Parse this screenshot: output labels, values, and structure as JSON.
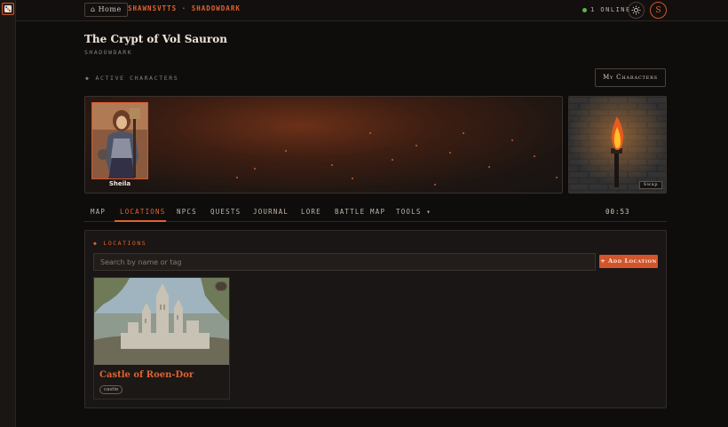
{
  "topbar": {
    "home_label": "Home",
    "brand": "SHAWNSVTTS · SHADOWDARK",
    "online": "1 ONLINE",
    "user_initial": "S"
  },
  "campaign": {
    "title": "The Crypt of Vol Sauron",
    "system": "SHADOWDARK"
  },
  "characters": {
    "heading": "ACTIVE CHARACTERS",
    "my_characters_label": "My Characters",
    "list": [
      {
        "name": "Sheila"
      }
    ]
  },
  "torch": {
    "swap_label": "Swap"
  },
  "tabs": [
    {
      "label": "MAP"
    },
    {
      "label": "LOCATIONS",
      "active": true
    },
    {
      "label": "NPCS"
    },
    {
      "label": "QUESTS"
    },
    {
      "label": "JOURNAL"
    },
    {
      "label": "LORE"
    },
    {
      "label": "BATTLE MAP"
    },
    {
      "label": "TOOLS ▾"
    }
  ],
  "timer": "00:53",
  "locations": {
    "heading": "LOCATIONS",
    "search_placeholder": "Search by name or tag",
    "add_label": "+ Add Location",
    "cards": [
      {
        "title": "Castle of Roen-Dor",
        "tags": [
          "castle"
        ]
      }
    ]
  },
  "colors": {
    "accent": "#e0632f",
    "background": "#0f0d0c",
    "online": "#5fb24c"
  },
  "icons": [
    "dice-icon",
    "home-icon",
    "sun-icon",
    "diamond-icon",
    "torch-icon"
  ]
}
